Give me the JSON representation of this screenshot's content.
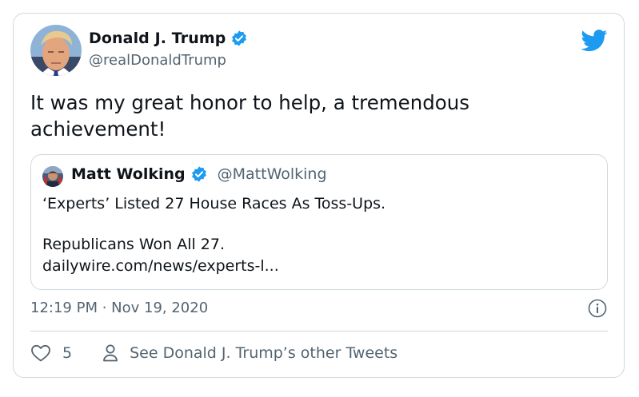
{
  "tweet": {
    "author_name": "Donald J. Trump",
    "author_handle": "@realDonaldTrump",
    "text_line1": "It was my great honor to help, a tremendous",
    "text_line2": "achievement!",
    "timestamp": "12:19 PM · Nov 19, 2020",
    "like_count": "5",
    "other_tweets_link": "See Donald J. Trump’s other Tweets"
  },
  "quote": {
    "author_name": "Matt Wolking",
    "author_handle": "@MattWolking",
    "line1": "‘Experts’ Listed 27 House Races As Toss-Ups.",
    "line2": "Republicans Won All 27.",
    "line3": "dailywire.com/news/experts-l..."
  },
  "icons": {
    "verified": "verified-badge-icon",
    "brand": "twitter-bird-icon",
    "info": "info-icon",
    "like": "heart-icon",
    "profile": "person-icon"
  },
  "colors": {
    "accent": "#1d9bf0",
    "text": "#0f1419",
    "secondary": "#536471",
    "border": "#cfd9de"
  }
}
